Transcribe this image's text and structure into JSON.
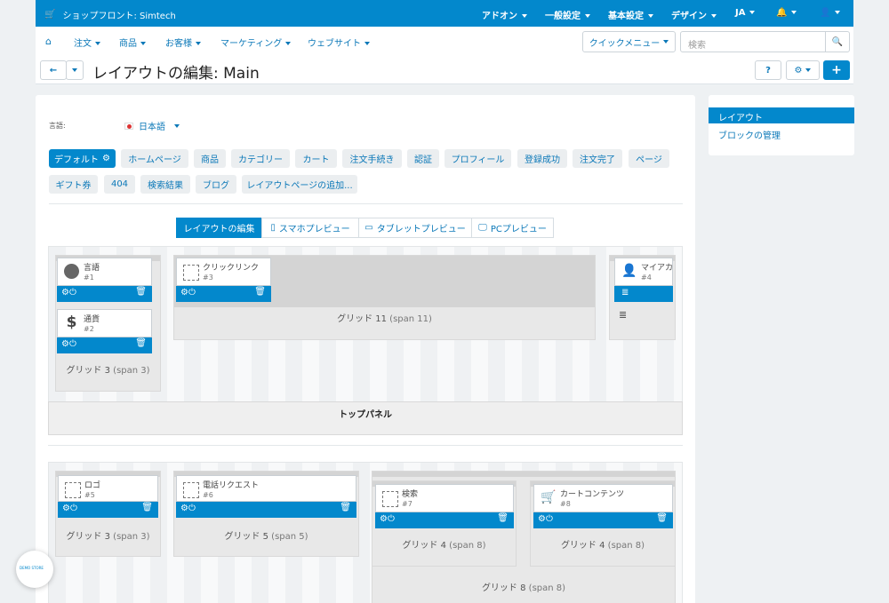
{
  "topbar": {
    "brand": "ショップフロント: Simtech",
    "menus": [
      "アドオン",
      "一般設定",
      "基本設定",
      "デザイン",
      "JA"
    ]
  },
  "subnav": {
    "items": [
      "注文",
      "商品",
      "お客様",
      "マーケティング",
      "ウェブサイト"
    ],
    "quick_menu": "クイックメニュー",
    "search_placeholder": "検索",
    "page_title": "レイアウトの編集: Main"
  },
  "side": {
    "items": [
      "レイアウト",
      "ブロックの管理"
    ]
  },
  "lang": {
    "label": "言語:",
    "value": "日本語"
  },
  "tabs_row1": [
    "デフォルト",
    "ホームページ",
    "商品",
    "カテゴリー",
    "カート",
    "注文手続き",
    "認証",
    "プロフィール",
    "登録成功",
    "注文完了",
    "ページ"
  ],
  "tabs_row2": [
    "ギフト券",
    "404",
    "検索結果",
    "ブログ",
    "レイアウトページの追加..."
  ],
  "preview": [
    "レイアウトの編集",
    "スマホプレビュー",
    "タブレットプレビュー",
    "PCプレビュー"
  ],
  "top_panel": {
    "title": "トップパネル",
    "g1": {
      "label": "グリッド 3",
      "span": "(span 3)"
    },
    "g2": {
      "label": "グリッド 11",
      "span": "(span 11)"
    },
    "blocks": [
      {
        "title": "言語",
        "num": "#1"
      },
      {
        "title": "通貨",
        "num": "#2"
      },
      {
        "title": "クリックリンク",
        "num": "#3"
      },
      {
        "title": "マイアカ",
        "num": "#4"
      }
    ]
  },
  "header_panel": {
    "g1": {
      "label": "グリッド 3",
      "span": "(span 3)"
    },
    "g2": {
      "label": "グリッド 5",
      "span": "(span 5)"
    },
    "g3": {
      "label": "グリッド 4",
      "span": "(span 8)"
    },
    "g4": {
      "label": "グリッド 4",
      "span": "(span 8)"
    },
    "g5": {
      "label": "グリッド 8",
      "span": "(span 8)"
    },
    "blocks": [
      {
        "title": "ロゴ",
        "num": "#5"
      },
      {
        "title": "電話リクエスト",
        "num": "#6"
      },
      {
        "title": "検索",
        "num": "#7"
      },
      {
        "title": "カートコンテンツ",
        "num": "#8"
      }
    ]
  },
  "badge": "DEMO STORE"
}
